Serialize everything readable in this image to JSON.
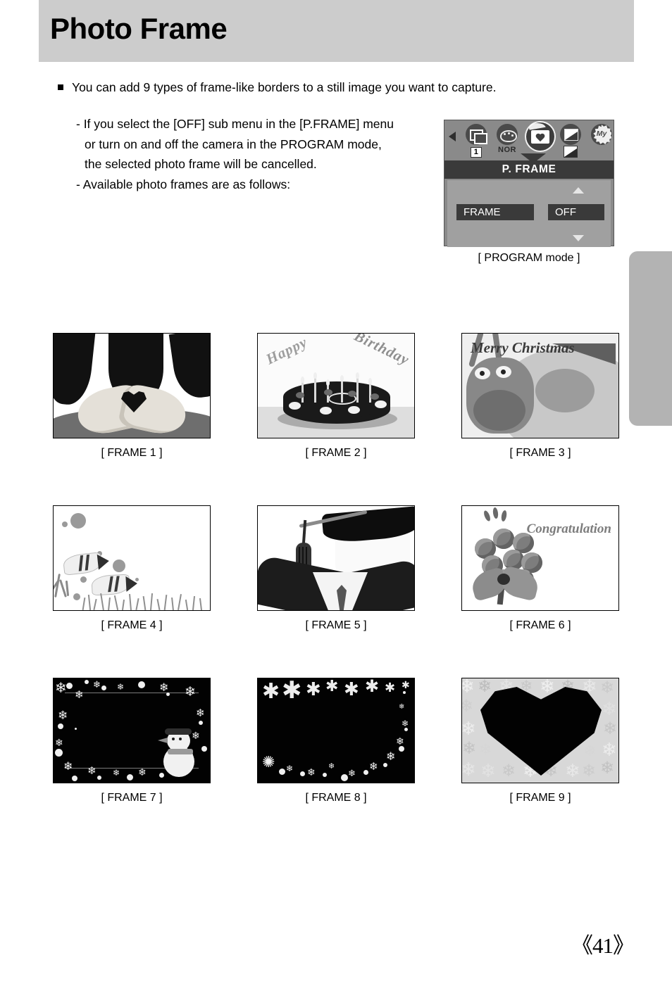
{
  "header": {
    "title": "Photo Frame"
  },
  "body": {
    "bullet": "You can add 9 types of frame-like borders to a still image you want to capture.",
    "lines": [
      "- If you select the [OFF] sub menu in the [P.FRAME] menu",
      "or turn on and off the camera in the PROGRAM mode,",
      "the selected photo frame will be cancelled.",
      "- Available photo frames are as follows:"
    ]
  },
  "lcd": {
    "caption": "[ PROGRAM mode ]",
    "title": "P. FRAME",
    "icons": [
      {
        "name": "continuous-shot-icon",
        "sub": "1",
        "boxed": true,
        "selected": false
      },
      {
        "name": "color-palette-icon",
        "sub": "NOR",
        "boxed": false,
        "selected": false
      },
      {
        "name": "photo-frame-icon",
        "sub": "",
        "boxed": false,
        "selected": true
      },
      {
        "name": "image-effect-icon",
        "sub": "",
        "boxed": false,
        "selected": false
      },
      {
        "name": "my-setting-star-icon",
        "sub": "My",
        "boxed": false,
        "selected": false
      }
    ],
    "menu_label": "FRAME",
    "menu_value": "OFF",
    "nav_left": "◀",
    "nav_right": "▶",
    "scroll_up": "▲",
    "scroll_down": "▼"
  },
  "frames": [
    {
      "caption": "[ FRAME 1 ]",
      "art": "hands-heart",
      "title": ""
    },
    {
      "caption": "[ FRAME 2 ]",
      "art": "birthday-cake",
      "title_a": "Happy",
      "title_b": "Birthday"
    },
    {
      "caption": "[ FRAME 3 ]",
      "art": "christmas-reindeer",
      "title": "Merry Christmas"
    },
    {
      "caption": "[ FRAME 4 ]",
      "art": "aquarium-fish",
      "title": ""
    },
    {
      "caption": "[ FRAME 5 ]",
      "art": "graduation",
      "title": ""
    },
    {
      "caption": "[ FRAME 6 ]",
      "art": "rose-bouquet",
      "title": "Congratulation"
    },
    {
      "caption": "[ FRAME 7 ]",
      "art": "snow-snowman",
      "title": ""
    },
    {
      "caption": "[ FRAME 8 ]",
      "art": "fireworks-snow",
      "title": ""
    },
    {
      "caption": "[ FRAME 9 ]",
      "art": "flower-heart",
      "title": ""
    }
  ],
  "footer": {
    "page": "《41》"
  },
  "colors": {
    "header_band": "#cccccc",
    "side_tab": "#b3b3b3",
    "lcd_body": "#8a8a8a",
    "lcd_titlebar": "#3a3a3a",
    "lcd_panel": "#a0a0a0",
    "text": "#000000"
  }
}
